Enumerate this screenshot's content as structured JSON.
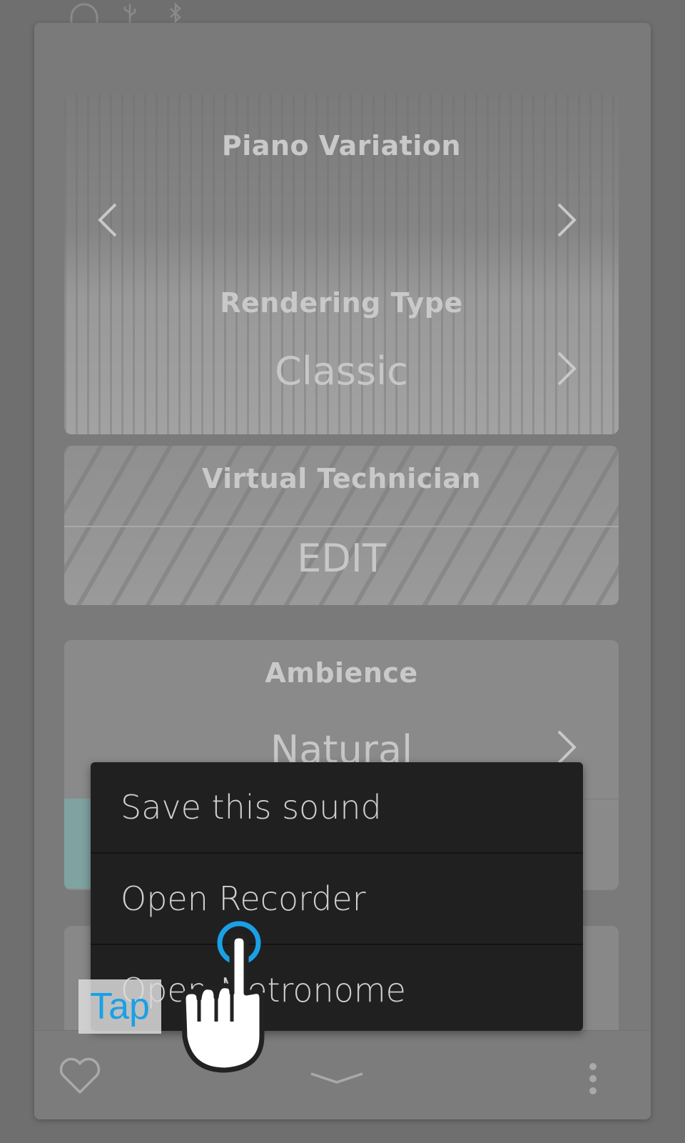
{
  "status_bar": {
    "icons": [
      "headphones-icon",
      "usb-icon",
      "bluetooth-icon"
    ]
  },
  "sound_panel": {
    "piano_variation": {
      "title": "Piano Variation"
    },
    "rendering_type": {
      "title": "Rendering Type",
      "value": "Classic"
    },
    "virtual_technician": {
      "title": "Virtual Technician",
      "action": "EDIT"
    },
    "ambience": {
      "title": "Ambience",
      "value": "Natural"
    }
  },
  "context_menu": {
    "items": [
      {
        "label": "Save this sound"
      },
      {
        "label": "Open Recorder"
      },
      {
        "label": "Open Metronome"
      }
    ]
  },
  "tutorial_overlay": {
    "gesture_label": "Tap",
    "gesture_color": "#1aa0e6"
  },
  "bottom_bar": {
    "icons": [
      "favorite-heart-icon",
      "collapse-chevron-icon",
      "more-options-icon"
    ]
  }
}
